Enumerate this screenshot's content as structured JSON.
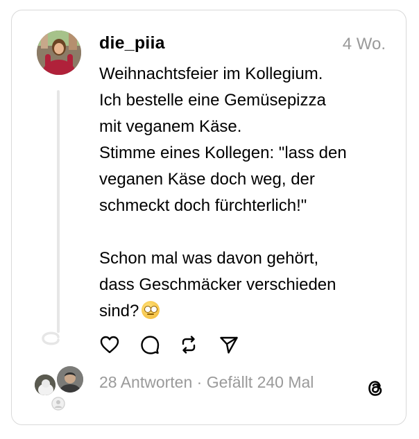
{
  "post": {
    "username": "die_piia",
    "timestamp": "4 Wo.",
    "text": "Weihnachtsfeier im Kollegium.\nIch bestelle eine Gemüsepizza\nmit veganem Käse.\nStimme eines Kollegen: \"lass den\nveganen Käse doch weg, der\nschmeckt doch fürchterlich!\"\n\nSchon mal was davon gehört,\ndass Geschmäcker verschieden\nsind?",
    "emoji": "face-with-rolling-eyes"
  },
  "actions": {
    "like_icon": "heart-icon",
    "comment_icon": "comment-icon",
    "repost_icon": "repost-icon",
    "share_icon": "send-icon"
  },
  "stats": {
    "replies": "28 Antworten",
    "separator": " · ",
    "likes": "Gefällt 240 Mal"
  },
  "brand": {
    "logo": "threads-logo-icon"
  },
  "colors": {
    "muted_text": "#9a9a9a",
    "border": "#d9d9d9",
    "thread_line": "#e6e6e6"
  }
}
